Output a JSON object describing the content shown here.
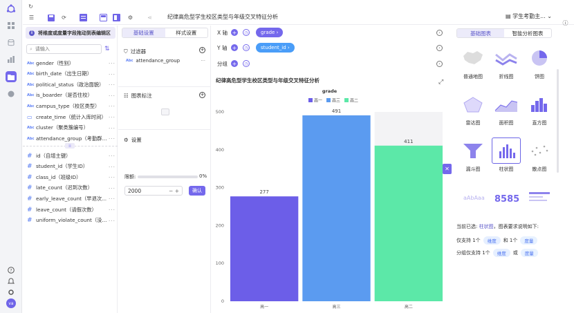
{
  "topbar": {
    "title": "纪律高危型学生校区类型与年级交叉特征分析",
    "dataset": "学生考勤主..."
  },
  "fields_panel": {
    "hint": "将维度或度量字段拖动到表编辑区",
    "search_placeholder": "请输入",
    "dimensions": [
      {
        "type": "Abc",
        "name": "gender（性别）"
      },
      {
        "type": "Abc",
        "name": "birth_date（出生日期）"
      },
      {
        "type": "Abc",
        "name": "political_status（政治面貌）"
      },
      {
        "type": "Abc",
        "name": "is_boarder（是否住校）"
      },
      {
        "type": "Abc",
        "name": "campus_type（校区类型）"
      },
      {
        "type": "date",
        "name": "create_time（统计入库时间）"
      },
      {
        "type": "Abc",
        "name": "cluster（聚类簇编号）"
      },
      {
        "type": "Abc",
        "name": "attendance_group（考勤群..."
      }
    ],
    "measures": [
      {
        "type": "#",
        "name": "id（自增主键）"
      },
      {
        "type": "#",
        "name": "student_id（学生ID）"
      },
      {
        "type": "#",
        "name": "class_id（班级ID）"
      },
      {
        "type": "#",
        "name": "late_count（迟到次数）"
      },
      {
        "type": "#",
        "name": "early_leave_count（早退次..."
      },
      {
        "type": "#",
        "name": "leave_count（请假次数）"
      },
      {
        "type": "#",
        "name": "uniform_violate_count（没..."
      }
    ]
  },
  "settings_panel": {
    "tab_basic": "基础设置",
    "tab_style": "样式设置",
    "filter_title": "过滤器",
    "filter_field": "attendance_group",
    "annotation_title": "图表标注",
    "settings_title": "设置",
    "limit_label": "限额:",
    "limit_percent": "0%",
    "limit_value": "2000",
    "confirm": "确认"
  },
  "chart_editor": {
    "x_label": "X 轴",
    "x_field": "grade",
    "y_label": "Y 轴",
    "y_field": "student_id",
    "group_label": "分组",
    "chart_title": "纪律高危型学生校区类型与年级交叉特征分析"
  },
  "chart_types": {
    "tab_basic": "基础图表",
    "tab_smart": "智能分析图表",
    "items": [
      "普通地图",
      "折线图",
      "饼图",
      "雷达图",
      "面积图",
      "直方图",
      "漏斗图",
      "柱状图",
      "散点图"
    ],
    "selected_label": "当前已选:",
    "selected": "柱状图",
    "requirement": "，图表要求说明如下:",
    "req1_pre": "仅支持 1个",
    "req1_a": "维度",
    "req1_mid": "和 1个",
    "req1_b": "度量",
    "req2_pre": "分组仅支持 1个",
    "req2_a": "维度",
    "req2_mid": "或",
    "req2_b": "度量",
    "colors": {
      "accent": "#7468ec"
    }
  },
  "chart_data": {
    "type": "bar",
    "legend_title": "grade",
    "categories": [
      "高一",
      "高三",
      "高二"
    ],
    "values": [
      277,
      491,
      411
    ],
    "colors": [
      "#6c5ee8",
      "#5b9bf0",
      "#5ce8a8"
    ],
    "ylim": [
      0,
      500
    ],
    "yticks": [
      0,
      100,
      200,
      300,
      400,
      500
    ],
    "legend_placement": "top-center",
    "grid": false
  }
}
